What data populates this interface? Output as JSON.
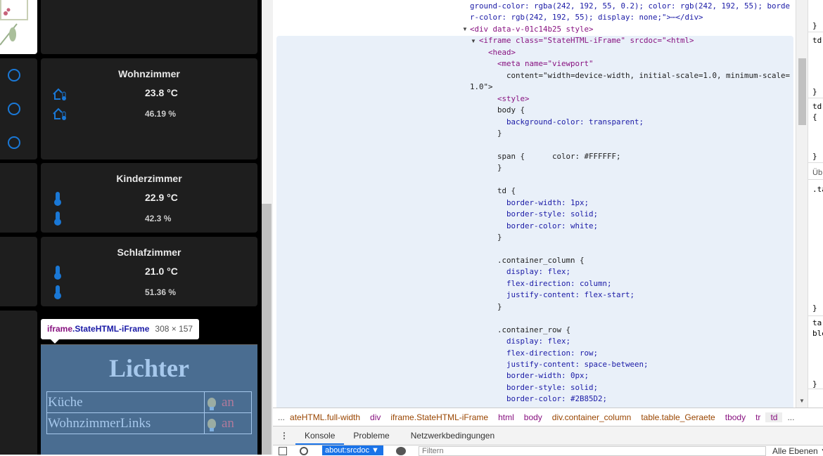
{
  "dashboard": {
    "rooms": [
      {
        "name": "Wohnzimmer",
        "temp": "23.8 °C",
        "humidity": "46.19 %"
      },
      {
        "name": "Kinderzimmer",
        "temp": "22.9 °C",
        "humidity": "42.3 %"
      },
      {
        "name": "Schlafzimmer",
        "temp": "21.0 °C",
        "humidity": "51.36 %"
      }
    ],
    "lights": {
      "title": "Lichter",
      "items": [
        {
          "name": "Küche",
          "state": "an"
        },
        {
          "name": "WohnzimmerLinks",
          "state": "an"
        }
      ]
    },
    "accent": "#1a78d6"
  },
  "inspector_tooltip": {
    "tag": "iframe",
    "cls": ".StateHTML-iFrame",
    "size": "308 × 157"
  },
  "code_lines": [
    "ground-color: rgba(242, 192, 55, 0.2); color: rgb(242, 192, 55); borde",
    "r-color: rgb(242, 192, 55); display: none;\">⋯</div>",
    "<div data-v-01c14b25 style>",
    "  <iframe class=\"StateHTML-iFrame\" srcdoc=\"<html>",
    "    <head>",
    "      <meta name=\"viewport\"",
    "        content=\"width=device-width, initial-scale=1.0, minimum-scale=",
    "1.0\">",
    "      <style>",
    "      body {",
    "        background-color: transparent;",
    "      }",
    "",
    "      span {      color: #FFFFFF;",
    "      }",
    "",
    "      td {",
    "        border-width: 1px;",
    "        border-style: solid;",
    "        border-color: white;",
    "      }",
    "",
    "      .container_column {",
    "        display: flex;",
    "        flex-direction: column;",
    "        justify-content: flex-start;",
    "      }",
    "",
    "      .container_row {",
    "        display: flex;",
    "        flex-direction: row;",
    "        justify-content: space-between;",
    "        border-width: 0px;",
    "        border-style: solid;",
    "        border-color: #2B85D2;",
    "      }"
  ],
  "styles_pane": [
    "}",
    "td",
    "}",
    "td",
    "{",
    "}",
    "Üb",
    ".ta",
    "}",
    "ta",
    "ble",
    "}"
  ],
  "breadcrumbs": [
    "...",
    "ateHTML.full-width",
    "div",
    "iframe.StateHTML-iFrame",
    "html",
    "body",
    "div.container_column",
    "table.table_Geraete",
    "tbody",
    "tr",
    "td",
    "..."
  ],
  "drawer_tabs": [
    "Konsole",
    "Probleme",
    "Netzwerkbedingungen"
  ],
  "console_toolbar": {
    "context": "about:srcdoc ▼",
    "filter_placeholder": "Filtern",
    "levels": "Alle Ebenen ▼"
  }
}
